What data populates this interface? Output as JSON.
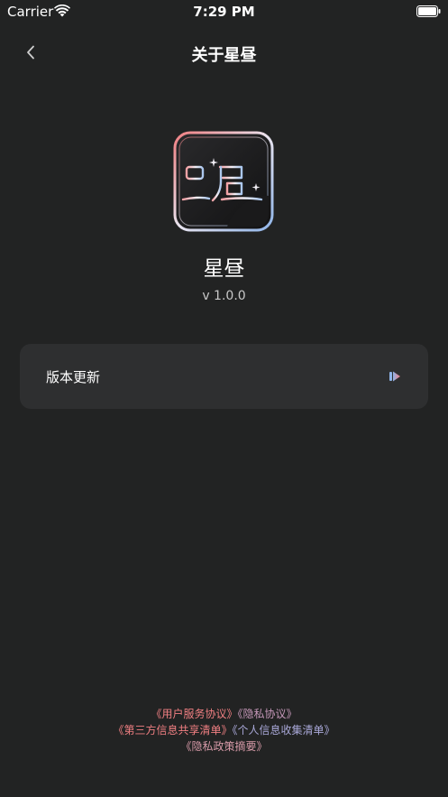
{
  "status_bar": {
    "carrier": "Carrier",
    "time": "7:29 PM"
  },
  "nav": {
    "title": "关于星昼"
  },
  "app": {
    "name": "星昼",
    "version": "v 1.0.0"
  },
  "menu": {
    "items": [
      {
        "label": "版本更新"
      }
    ]
  },
  "footer": {
    "links": {
      "user_agreement": "《用户服务协议》",
      "privacy_agreement": "《隐私协议》",
      "third_party_list": "《第三方信息共享清单》",
      "personal_info_list": "《个人信息收集清单》",
      "privacy_summary": "《隐私政策摘要》"
    }
  },
  "colors": {
    "background": "#222323",
    "card": "#2e2f30",
    "link_red": "#f07f82",
    "link_blue": "#8fb4e8",
    "link_mix": "#c597b8"
  }
}
